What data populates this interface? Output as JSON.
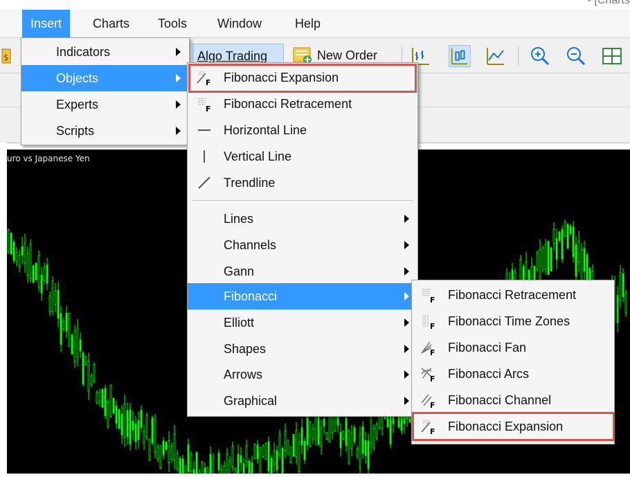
{
  "window": {
    "title_fragment": "- [Charts"
  },
  "menubar": {
    "items": [
      "Insert",
      "Charts",
      "Tools",
      "Window",
      "Help"
    ]
  },
  "toolbar": {
    "algo_trading_label": "Algo Trading",
    "new_order_label": "New Order"
  },
  "chart": {
    "symbol_label": "uro vs Japanese Yen",
    "background": "#000000",
    "candle_color": "#00ff00"
  },
  "insert_menu": {
    "items": [
      "Indicators",
      "Objects",
      "Experts",
      "Scripts"
    ],
    "selected": "Objects"
  },
  "objects_menu": {
    "top_items": [
      "Fibonacci Expansion",
      "Fibonacci Retracement",
      "Horizontal Line",
      "Vertical Line",
      "Trendline"
    ],
    "sub_items": [
      "Lines",
      "Channels",
      "Gann",
      "Fibonacci",
      "Elliott",
      "Shapes",
      "Arrows",
      "Graphical"
    ],
    "selected": "Fibonacci"
  },
  "fibonacci_menu": {
    "items": [
      "Fibonacci Retracement",
      "Fibonacci Time Zones",
      "Fibonacci Fan",
      "Fibonacci Arcs",
      "Fibonacci Channel",
      "Fibonacci Expansion"
    ]
  },
  "colors": {
    "menu_highlight": "#3399ff",
    "annotation_box": "#d9534f"
  }
}
